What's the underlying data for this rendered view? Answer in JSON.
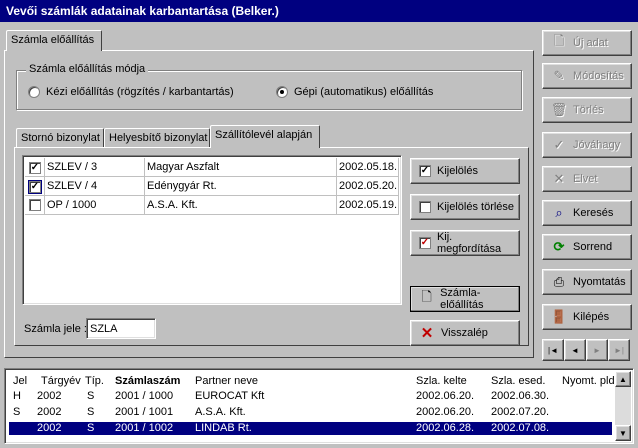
{
  "window": {
    "title": "Vevői számlák adatainak karbantartása (Belker.)"
  },
  "main_tab": {
    "label": "Számla előállítás"
  },
  "mode_group": {
    "label": "Számla előállítás módja",
    "options": [
      {
        "label": "Kézi előállítás (rögzítés / karbantartás)",
        "selected": false
      },
      {
        "label": "Gépi (automatikus) előállítás",
        "selected": true
      }
    ]
  },
  "sub_tabs": [
    {
      "label": "Stornó bizonylat",
      "active": false
    },
    {
      "label": "Helyesbítő bizonylat",
      "active": false
    },
    {
      "label": "Szállítólevél alapján",
      "active": true
    }
  ],
  "delivery_rows": [
    {
      "checked": true,
      "doc": "SZLEV / 3",
      "partner": "Magyar Aszfalt",
      "date": "2002.05.18."
    },
    {
      "checked": true,
      "doc": "SZLEV / 4",
      "partner": "Edénygyár Rt.",
      "date": "2002.05.20."
    },
    {
      "checked": false,
      "doc": "OP / 1000",
      "partner": "A.S.A. Kft.",
      "date": "2002.05.19."
    }
  ],
  "inner_buttons": {
    "select": "Kijelölés",
    "clear": "Kijelölés törlése",
    "invert": "Kij. megfordítása",
    "generate": "Számla-előállítás",
    "back": "Visszalép"
  },
  "invoice_mark": {
    "label": "Számla jele :",
    "value": "SZLA"
  },
  "side_buttons": {
    "new": "Új adat",
    "modify": "Módosítás",
    "delete": "Törlés",
    "approve": "Jóváhagy",
    "discard": "Elvet",
    "search": "Keresés",
    "order": "Sorrend",
    "print": "Nyomtatás",
    "exit": "Kilépés"
  },
  "nav_glyphs": {
    "first": "|◄",
    "prev": "◄",
    "next": "►",
    "last": "►|"
  },
  "list": {
    "headers": {
      "jel": "Jel",
      "year": "Tárgyév",
      "type": "Típ.",
      "number": "Számlaszám",
      "partner": "Partner neve",
      "issued": "Szla. kelte",
      "due": "Szla. esed.",
      "prints": "Nyomt. pld."
    },
    "rows": [
      {
        "jel": "H",
        "year": "2002",
        "type": "S",
        "number": "2001 / 1000",
        "partner": "EUROCAT Kft",
        "issued": "2002.06.20.",
        "due": "2002.06.30.",
        "selected": false
      },
      {
        "jel": "S",
        "year": "2002",
        "type": "S",
        "number": "2001 / 1001",
        "partner": "A.S.A. Kft.",
        "issued": "2002.06.20.",
        "due": "2002.07.20.",
        "selected": false
      },
      {
        "jel": "",
        "year": "2002",
        "type": "S",
        "number": "2001 / 1002",
        "partner": "LINDAB Rt.",
        "issued": "2002.06.28.",
        "due": "2002.07.08.",
        "selected": true
      }
    ]
  },
  "colors": {
    "titlebar": "#000080",
    "selection": "#000080",
    "face": "#c0c0c0"
  }
}
